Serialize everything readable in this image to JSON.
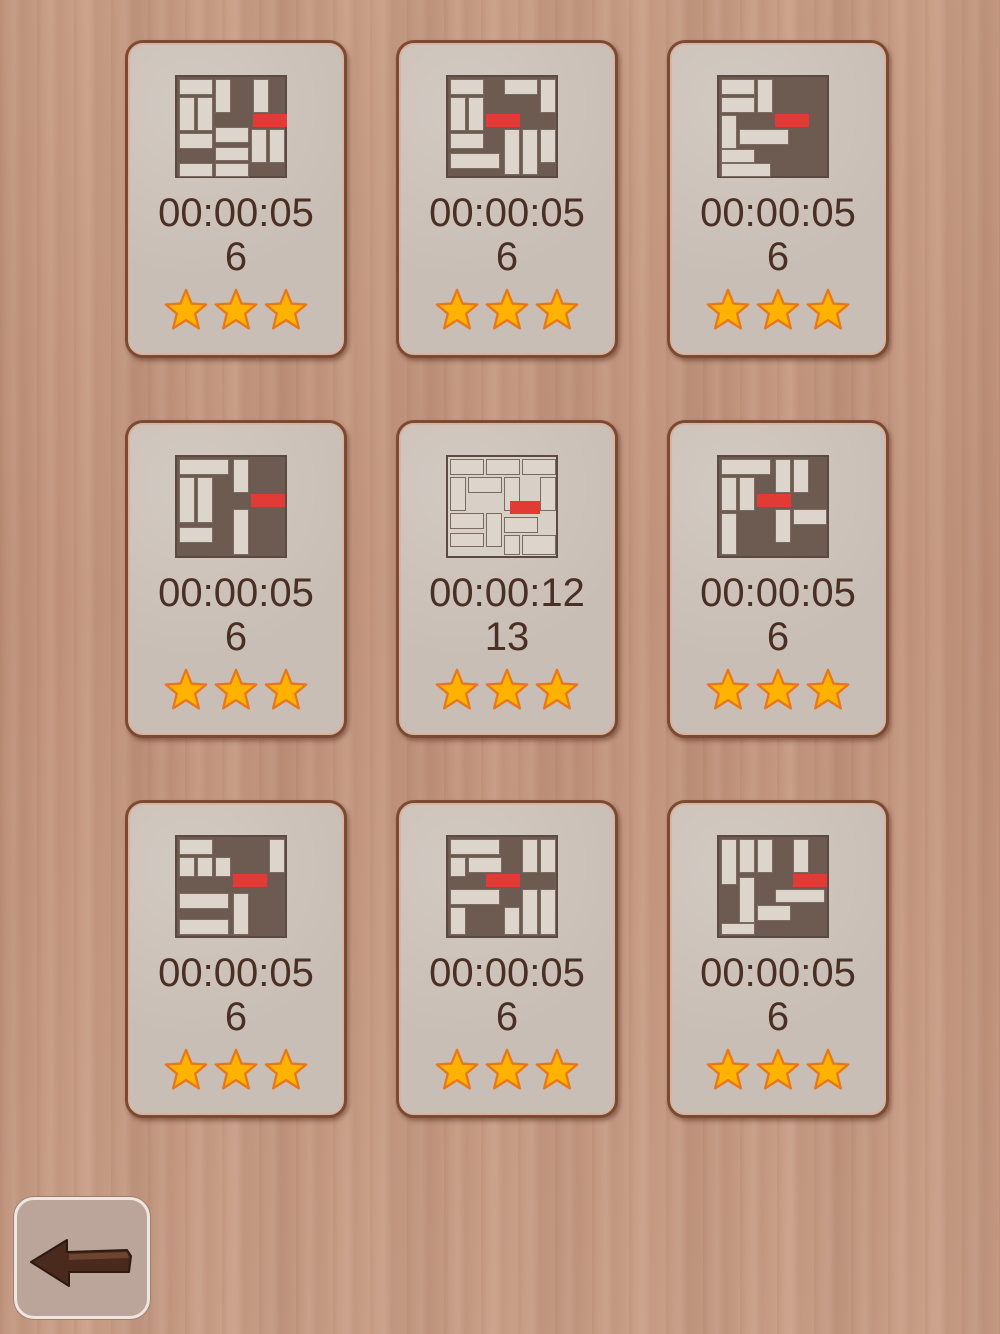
{
  "levels": [
    {
      "time": "00:00:05",
      "moves": "6",
      "stars": 3
    },
    {
      "time": "00:00:05",
      "moves": "6",
      "stars": 3
    },
    {
      "time": "00:00:05",
      "moves": "6",
      "stars": 3
    },
    {
      "time": "00:00:05",
      "moves": "6",
      "stars": 3
    },
    {
      "time": "00:00:12",
      "moves": "13",
      "stars": 3
    },
    {
      "time": "00:00:05",
      "moves": "6",
      "stars": 3
    },
    {
      "time": "00:00:05",
      "moves": "6",
      "stars": 3
    },
    {
      "time": "00:00:05",
      "moves": "6",
      "stars": 3
    },
    {
      "time": "00:00:05",
      "moves": "6",
      "stars": 3
    }
  ],
  "icons": {
    "back": "left-arrow-icon",
    "star": "star-icon"
  },
  "colors": {
    "star_fill": "#ffb300",
    "star_edge": "#e8761a",
    "target_block": "#e23a35",
    "text": "#4a2f24"
  }
}
